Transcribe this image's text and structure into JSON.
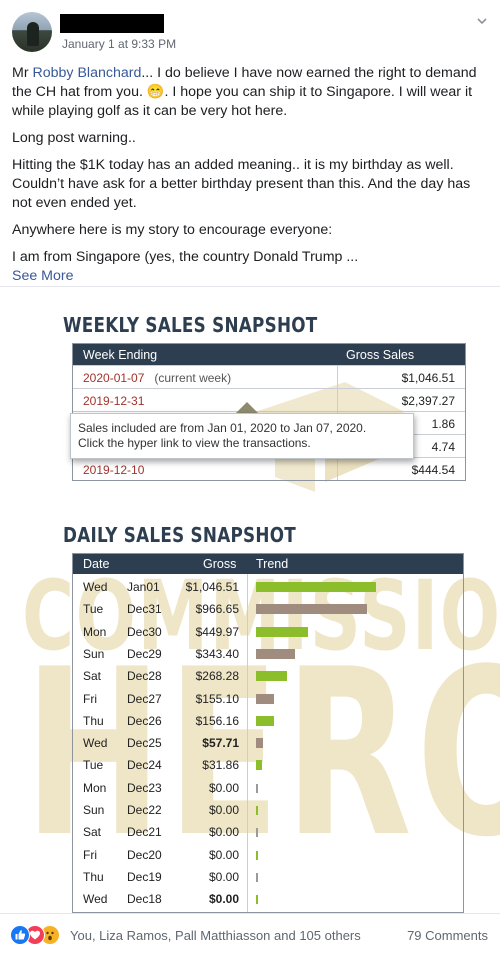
{
  "post": {
    "timestamp": "January 1 at 9:33 PM",
    "p1_prefix": "Mr ",
    "p1_mention": "Robby Blanchard",
    "p1_rest": "... I do believe I have now earned the right to demand the CH hat from you. 😁. I hope you can ship it to Singapore. I will wear it while playing golf as it can be very hot here.",
    "p2": "Long post warning..",
    "p3": "Hitting the $1K today has an added meaning.. it is my birthday as well. Couldn’t have ask for a better birthday present than this. And the day has not even ended yet.",
    "p4": "Anywhere here is my story to encourage everyone:",
    "p5": "I am from Singapore (yes, the country  Donald Trump ...",
    "see_more": "See More"
  },
  "image": {
    "watermark_line1": "COMMISSION",
    "watermark_line2": "HERO",
    "weekly": {
      "title": "WEEKLY SALES SNAPSHOT",
      "columns": [
        "Week Ending",
        "Gross Sales"
      ],
      "rows": [
        {
          "date": "2020-01-07",
          "note": "(current week)",
          "value": "$1,046.51"
        },
        {
          "date": "2019-12-31",
          "note": "",
          "value": "$2,397.27"
        },
        {
          "date": "",
          "note": "",
          "value": "1.86"
        },
        {
          "date": "",
          "note": "",
          "value": "4.74"
        },
        {
          "date": "2019-12-10",
          "note": "",
          "value": "$444.54"
        }
      ],
      "tooltip_line1": "Sales included are from Jan 01, 2020 to Jan 07, 2020.",
      "tooltip_line2": "Click the hyper link to view the transactions."
    },
    "daily": {
      "title": "DAILY SALES SNAPSHOT",
      "columns": [
        "Date",
        "Gross",
        "Trend"
      ],
      "rows": [
        {
          "day": "Wed",
          "date": "Jan01",
          "gross": "$1,046.51",
          "value": 1046.51,
          "bold": false,
          "color": "green"
        },
        {
          "day": "Tue",
          "date": "Dec31",
          "gross": "$966.65",
          "value": 966.65,
          "bold": false,
          "color": "brown"
        },
        {
          "day": "Mon",
          "date": "Dec30",
          "gross": "$449.97",
          "value": 449.97,
          "bold": false,
          "color": "green"
        },
        {
          "day": "Sun",
          "date": "Dec29",
          "gross": "$343.40",
          "value": 343.4,
          "bold": false,
          "color": "brown"
        },
        {
          "day": "Sat",
          "date": "Dec28",
          "gross": "$268.28",
          "value": 268.28,
          "bold": false,
          "color": "green"
        },
        {
          "day": "Fri",
          "date": "Dec27",
          "gross": "$155.10",
          "value": 155.1,
          "bold": false,
          "color": "brown"
        },
        {
          "day": "Thu",
          "date": "Dec26",
          "gross": "$156.16",
          "value": 156.16,
          "bold": false,
          "color": "green"
        },
        {
          "day": "Wed",
          "date": "Dec25",
          "gross": "$57.71",
          "value": 57.71,
          "bold": true,
          "color": "brown"
        },
        {
          "day": "Tue",
          "date": "Dec24",
          "gross": "$31.86",
          "value": 31.86,
          "bold": false,
          "color": "green"
        },
        {
          "day": "Mon",
          "date": "Dec23",
          "gross": "$0.00",
          "value": 0,
          "bold": false,
          "color": "brown"
        },
        {
          "day": "Sun",
          "date": "Dec22",
          "gross": "$0.00",
          "value": 0,
          "bold": false,
          "color": "green"
        },
        {
          "day": "Sat",
          "date": "Dec21",
          "gross": "$0.00",
          "value": 0,
          "bold": false,
          "color": "brown"
        },
        {
          "day": "Fri",
          "date": "Dec20",
          "gross": "$0.00",
          "value": 0,
          "bold": false,
          "color": "green"
        },
        {
          "day": "Thu",
          "date": "Dec19",
          "gross": "$0.00",
          "value": 0,
          "bold": false,
          "color": "brown"
        },
        {
          "day": "Wed",
          "date": "Dec18",
          "gross": "$0.00",
          "value": 0,
          "bold": true,
          "color": "green"
        }
      ]
    }
  },
  "footer": {
    "reactions_text": "You, Liza Ramos, Pall Matthiasson and 105 others",
    "comments": "79 Comments"
  },
  "colors": {
    "link": "#385898",
    "header_navy": "#2d3e50",
    "date_red": "#a2332c",
    "bar_green": "#8cbd2a",
    "bar_brown": "#a08c7e",
    "like_blue": "#1877f2",
    "love_red": "#f33e58",
    "wow_yellow": "#f7b125"
  },
  "icons": [
    "chevron-down-icon",
    "like-reaction-icon",
    "love-reaction-icon",
    "wow-reaction-icon"
  ]
}
